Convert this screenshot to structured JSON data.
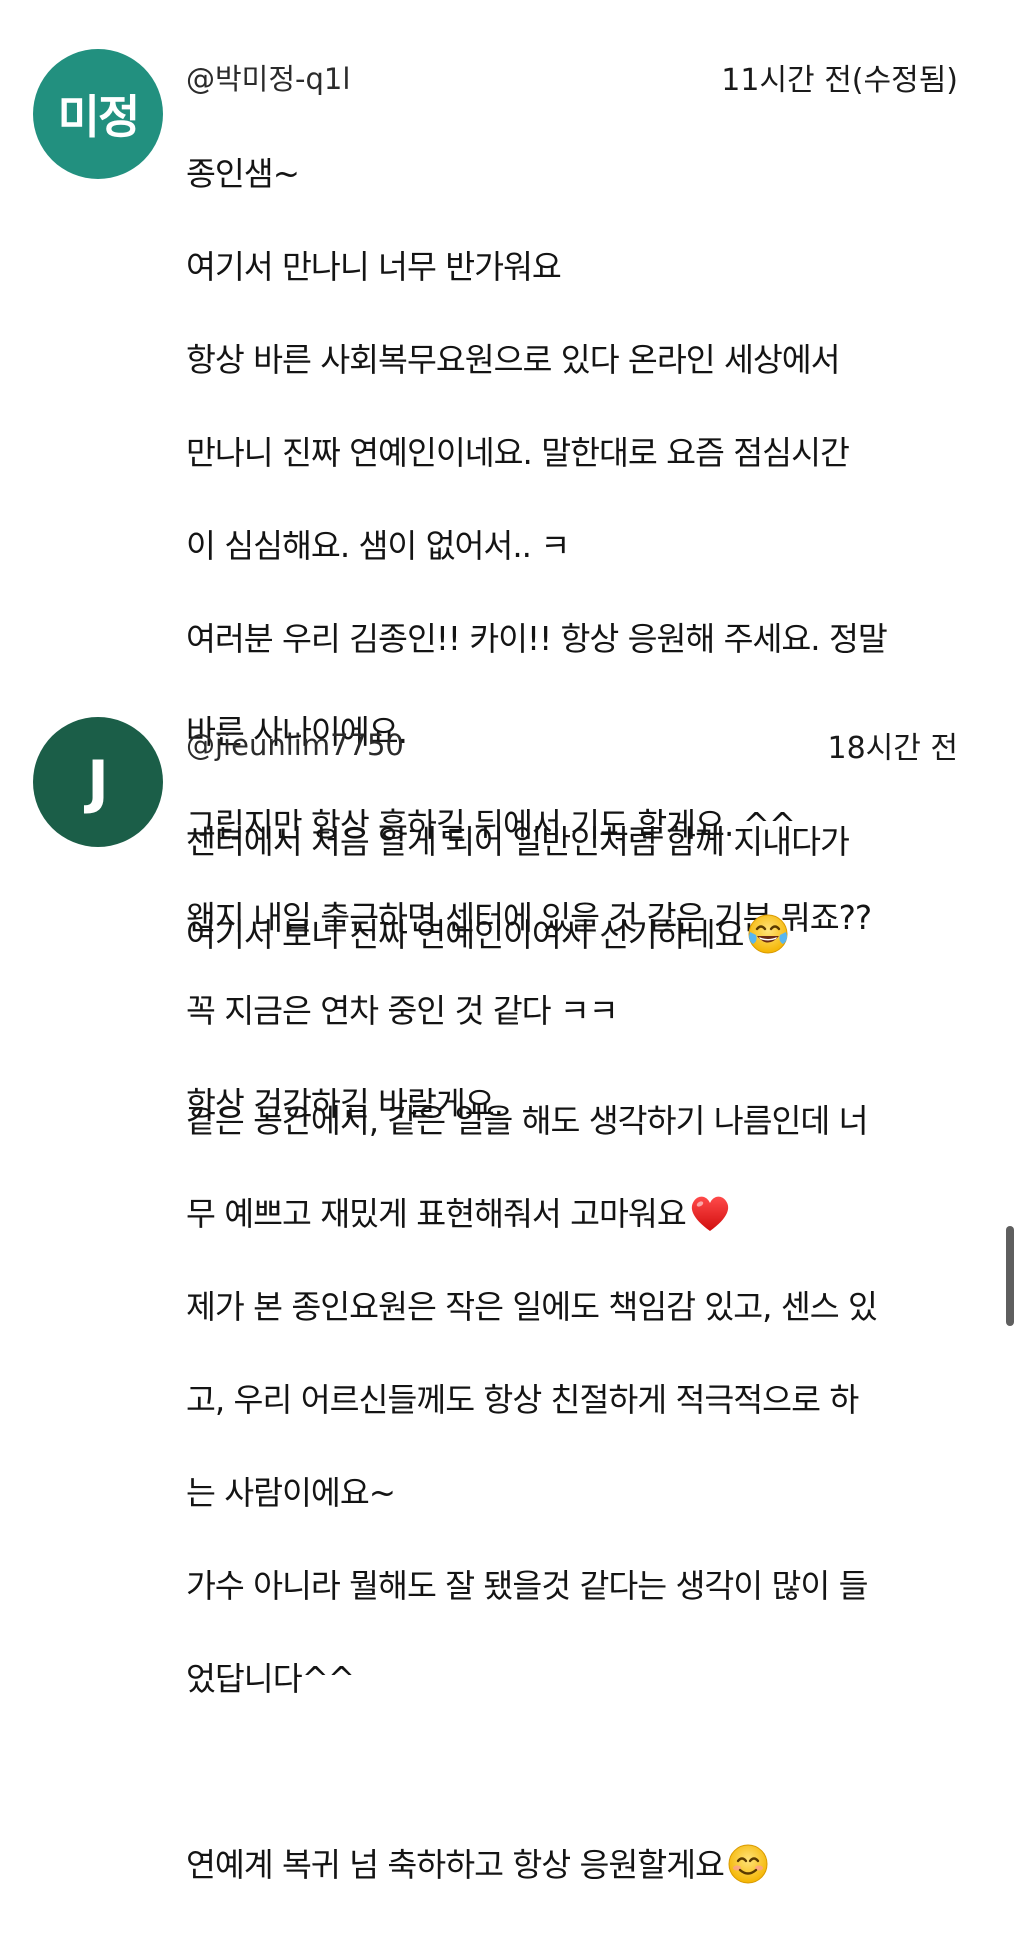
{
  "colors": {
    "avatar1": "#22907f",
    "avatar2": "#1b5e48"
  },
  "comments": [
    {
      "avatar_text": "미정",
      "author": "@박미정-q1l",
      "time": "11시간 전(수정됨)",
      "lines": [
        "종인샘~",
        "여기서 만나니 너무 반가워요",
        "항상 바른 사회복무요원으로 있다 온라인 세상에서",
        "만나니 진짜 연예인이네요. 말한대로 요즘 점심시간",
        "이 심심해요. 샘이 없어서.. ㅋ",
        "여러분 우리 김종인!! 카이!! 항상 응원해 주세요. 정말",
        "바른 사나이에요.",
        "그립지만 항상 흥하길 뒤에서 기도 할게요. ^^",
        "왠지 내일 출근하면 센터에 있을 것 같은 기분 뭐죠??",
        "꼭 지금은 연차 중인 것 같다 ㅋㅋ",
        "항상 건강하길 바랄게요."
      ]
    },
    {
      "avatar_text": "J",
      "author": "@jieunlim7750",
      "time": "18시간 전",
      "lines": [
        "센터에서 처음 알게 되어 일반인처럼 함께 지내다가",
        "여기서 보니 진짜 연예인이여서 신기하네요",
        "",
        "같은 공간에서, 같은 일을 해도 생각하기 나름인데 너",
        "무 예쁘고 재밌게 표현해줘서 고마워요",
        "제가 본 종인요원은 작은 일에도 책임감 있고, 센스 있",
        "고, 우리 어르신들께도 항상 친절하게 적극적으로 하",
        "는 사람이에요~",
        "가수 아니라 뭘해도 잘 됐을것 같다는 생각이 많이 들",
        "었답니다^^",
        "",
        "연예계 복귀 넘 축하하고 항상 응원할게요"
      ],
      "emojis": [
        "tears-of-joy-emoji",
        "red-heart-emoji",
        "smiling-face-emoji"
      ]
    }
  ]
}
